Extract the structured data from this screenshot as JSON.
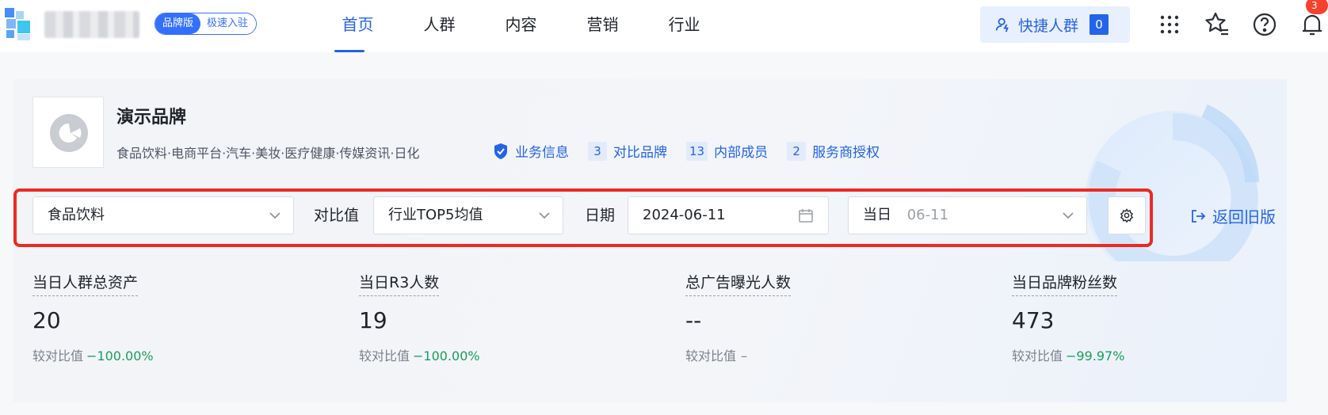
{
  "header": {
    "edition_primary": "品牌版",
    "edition_secondary": "极速入驻",
    "nav": [
      {
        "label": "首页",
        "active": true
      },
      {
        "label": "人群",
        "active": false
      },
      {
        "label": "内容",
        "active": false
      },
      {
        "label": "营销",
        "active": false
      },
      {
        "label": "行业",
        "active": false
      }
    ],
    "quick_crowd_label": "快捷人群",
    "quick_crowd_count": "0",
    "notification_badge": "3",
    "icons": [
      "apps-grid-icon",
      "star-list-icon",
      "help-icon",
      "bell-icon"
    ]
  },
  "brand": {
    "name": "演示品牌",
    "categories": "食品饮料·电商平台·汽车·美妆·医疗健康·传媒资讯·日化",
    "business_info": "业务信息",
    "links": [
      {
        "count": "3",
        "label": "对比品牌"
      },
      {
        "count": "13",
        "label": "内部成员"
      },
      {
        "count": "2",
        "label": "服务商授权"
      }
    ]
  },
  "filters": {
    "industry": "食品饮料",
    "compare_label": "对比值",
    "compare_value": "行业TOP5均值",
    "date_label": "日期",
    "date_value": "2024-06-11",
    "period_prefix": "当日",
    "period_value": "06-11",
    "back_old": "返回旧版"
  },
  "metrics": [
    {
      "label": "当日人群总资产",
      "value": "20",
      "cmp_label": "较对比值",
      "cmp_value": "−100.00%"
    },
    {
      "label": "当日R3人数",
      "value": "19",
      "cmp_label": "较对比值",
      "cmp_value": "−100.00%"
    },
    {
      "label": "总广告曝光人数",
      "value": "--",
      "cmp_label": "较对比值",
      "cmp_value": "–"
    },
    {
      "label": "当日品牌粉丝数",
      "value": "473",
      "cmp_label": "较对比值",
      "cmp_value": "−99.97%"
    }
  ],
  "colors": {
    "accent": "#2463eb",
    "positive": "#18a058",
    "highlight_border": "#ec2a22",
    "badge": "#f5412d"
  }
}
